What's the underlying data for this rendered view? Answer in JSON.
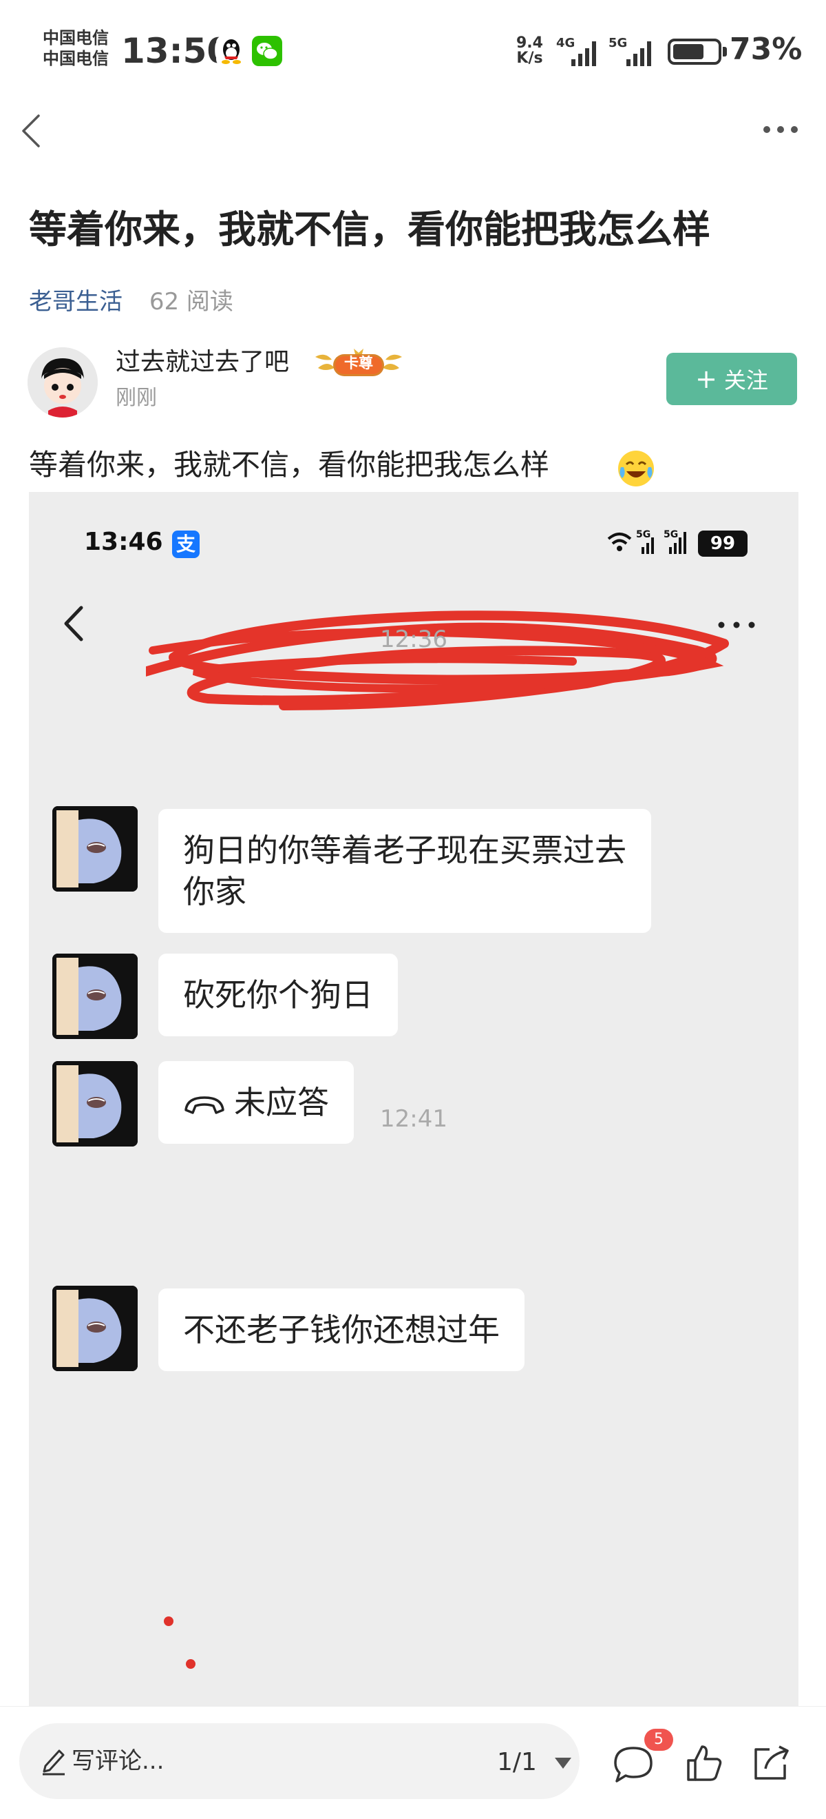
{
  "status_bar": {
    "carrier_1": "中国电信",
    "carrier_2": "中国电信",
    "time": "13:50",
    "net_speed_value": "9.4",
    "net_speed_unit": "K/s",
    "network_1": "4G",
    "network_2": "5G",
    "battery_percent": "73%",
    "battery_level": 0.73
  },
  "nav": {
    "back_icon": "chevron-left-icon",
    "more_icon": "more-dots-icon"
  },
  "article": {
    "title": "等着你来，我就不信，看你能把我怎么样",
    "channel": "老哥生活",
    "reads": "62 阅读",
    "author": {
      "name": "过去就过去了吧",
      "badge": "卡尊",
      "time": "刚刚"
    },
    "follow_label": "关注",
    "body_text": "等着你来，我就不信，看你能把我怎么样"
  },
  "embedded_screenshot": {
    "status_time": "13:46",
    "app_icon_glyph": "支",
    "network_1": "5G",
    "network_2": "5G",
    "battery": "99",
    "time_separators": [
      "12:36",
      "12:41"
    ],
    "messages": [
      {
        "lines": [
          "狗日的你等着老子现在买票过去",
          "你家"
        ]
      },
      {
        "lines": [
          "砍死你个狗日"
        ]
      },
      {
        "call": true,
        "lines": [
          "未应答"
        ]
      },
      {
        "lines": [
          "不还老子钱你还想过年"
        ]
      }
    ]
  },
  "bottom_bar": {
    "comment_placeholder": "写评论...",
    "page_indicator": "1/1",
    "comment_count": "5",
    "icons": [
      "pen-icon",
      "comment-icon",
      "thumbs-up-icon",
      "share-icon"
    ]
  },
  "colors": {
    "accent_link": "#3b5f92",
    "follow_button": "#5bb99a",
    "badge_red": "#f0544f",
    "scribble_red": "#e4342a"
  }
}
